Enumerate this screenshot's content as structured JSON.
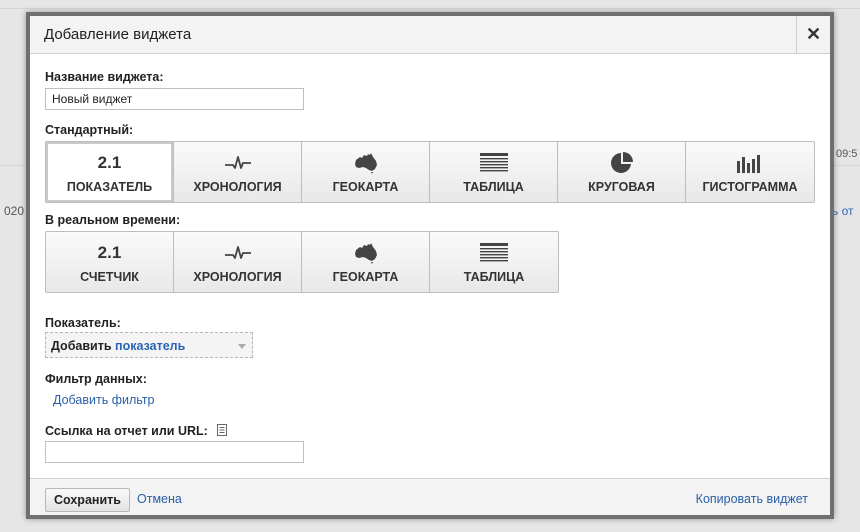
{
  "background": {
    "left_text": "020",
    "right_time": "09:5",
    "right_link": "ь от"
  },
  "dialog": {
    "title": "Добавление виджета",
    "close_symbol": "✕",
    "widget_name": {
      "label": "Название виджета:",
      "value": "Новый виджет"
    },
    "standard": {
      "label": "Стандартный:",
      "tiles": [
        {
          "label": "ПОКАЗАТЕЛЬ",
          "icon": "metric-number-icon",
          "icon_text": "2.1",
          "selected": true
        },
        {
          "label": "ХРОНОЛОГИЯ",
          "icon": "timeline-icon",
          "selected": false
        },
        {
          "label": "ГЕОКАРТА",
          "icon": "australia-map-icon",
          "selected": false
        },
        {
          "label": "ТАБЛИЦА",
          "icon": "table-icon",
          "selected": false
        },
        {
          "label": "КРУГОВАЯ",
          "icon": "pie-chart-icon",
          "selected": false
        },
        {
          "label": "ГИСТОГРАММА",
          "icon": "bar-chart-icon",
          "selected": false
        }
      ]
    },
    "realtime": {
      "label": "В реальном времени:",
      "tiles": [
        {
          "label": "СЧЕТЧИК",
          "icon": "counter-number-icon",
          "icon_text": "2.1"
        },
        {
          "label": "ХРОНОЛОГИЯ",
          "icon": "timeline-icon"
        },
        {
          "label": "ГЕОКАРТА",
          "icon": "australia-map-icon"
        },
        {
          "label": "ТАБЛИЦА",
          "icon": "table-icon"
        }
      ]
    },
    "metric": {
      "label": "Показатель:",
      "select_prefix": "Добавить",
      "select_accent": "показатель"
    },
    "filter": {
      "label": "Фильтр данных:",
      "add_link": "Добавить фильтр"
    },
    "report_link": {
      "label": "Ссылка на отчет или URL:",
      "value": ""
    },
    "footer": {
      "save": "Сохранить",
      "cancel": "Отмена",
      "copy": "Копировать виджет"
    },
    "colors": {
      "link": "#2a5fa8",
      "icon": "#444444",
      "frame": "#6f6f6f"
    }
  }
}
